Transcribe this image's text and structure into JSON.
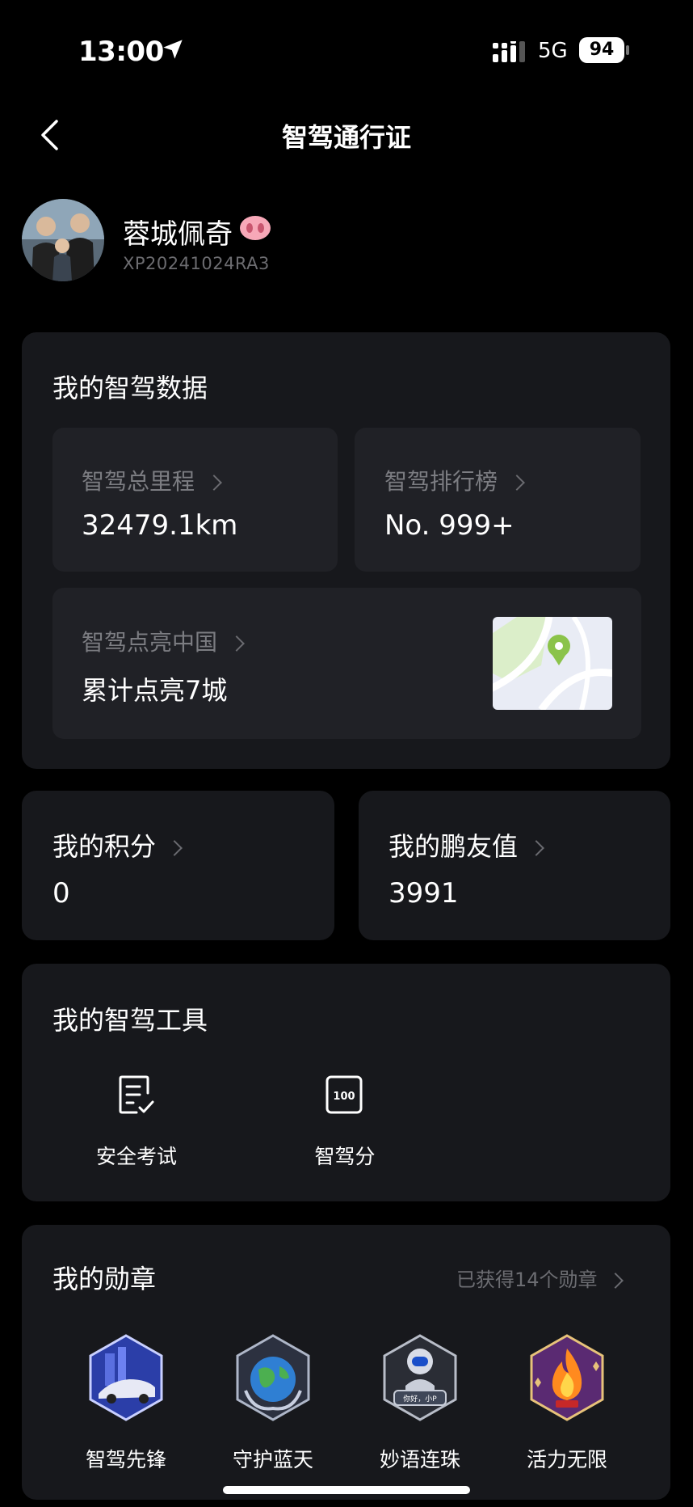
{
  "status_bar": {
    "time": "13:00",
    "network": "5G",
    "battery": "94"
  },
  "nav": {
    "title": "智驾通行证"
  },
  "profile": {
    "name": "蓉城佩奇",
    "id": "XP20241024RA3"
  },
  "smart_driving_data": {
    "title": "我的智驾数据",
    "total_mileage_label": "智驾总里程",
    "total_mileage_value": "32479.1km",
    "ranking_label": "智驾排行榜",
    "ranking_value": "No. 999+",
    "light_china_label": "智驾点亮中国",
    "light_china_value": "累计点亮7城"
  },
  "points": {
    "label": "我的积分",
    "value": "0"
  },
  "friend_value": {
    "label": "我的鹏友值",
    "value": "3991"
  },
  "tools": {
    "title": "我的智驾工具",
    "items": [
      {
        "label": "安全考试",
        "icon": "exam-checklist-icon"
      },
      {
        "label": "智驾分",
        "icon": "score-100-icon",
        "icon_text": "100"
      }
    ]
  },
  "medals": {
    "title": "我的勋章",
    "summary": "已获得14个勋章",
    "items": [
      {
        "label": "智驾先锋",
        "icon": "car-medal-icon"
      },
      {
        "label": "守护蓝天",
        "icon": "earth-medal-icon"
      },
      {
        "label": "妙语连珠",
        "icon": "robot-medal-icon",
        "icon_text": "你好，小P"
      },
      {
        "label": "活力无限",
        "icon": "fire-medal-icon"
      }
    ]
  },
  "colors": {
    "background": "#000000",
    "card": "#17181c",
    "inner_card": "#202126",
    "map_pin": "#8bc34a"
  }
}
